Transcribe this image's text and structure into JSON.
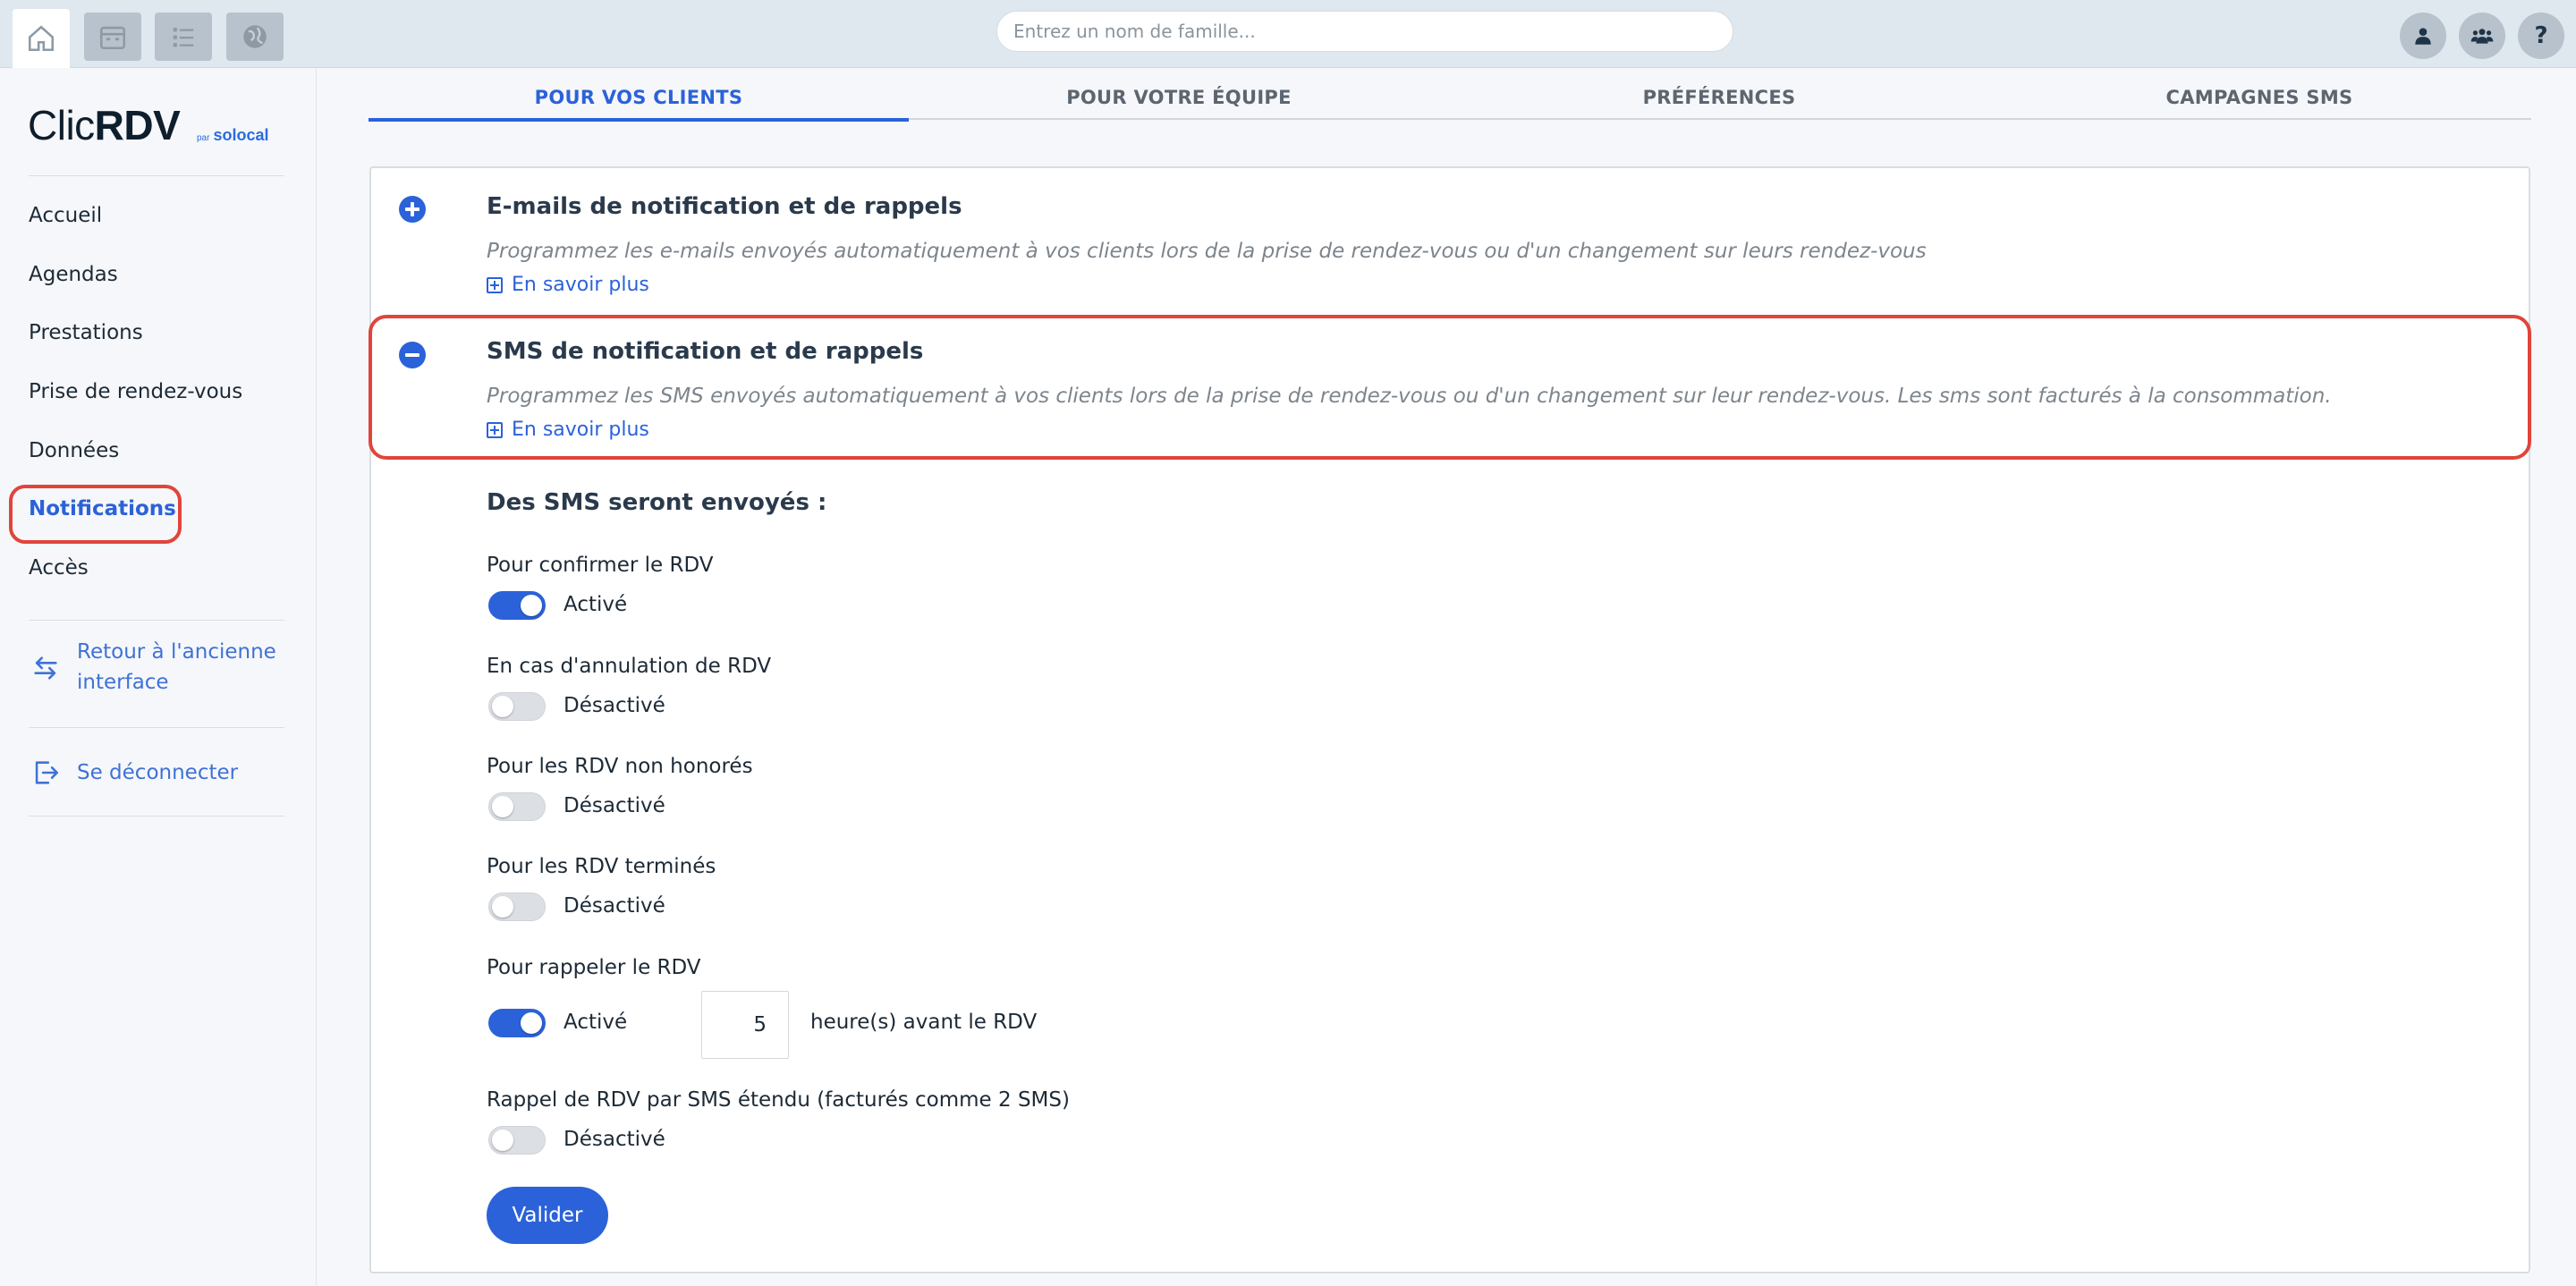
{
  "topbar": {
    "search_placeholder": "Entrez un nom de famille...",
    "icons": [
      "home-icon",
      "calendar-icon",
      "list-icon",
      "globe-icon",
      "user-icon",
      "team-icon",
      "help-icon"
    ],
    "help_glyph": "?"
  },
  "sidebar": {
    "logo_main": "Clic",
    "logo_bold": "RDV",
    "logo_by": "par",
    "logo_brand": "solocal",
    "items": [
      {
        "label": "Accueil"
      },
      {
        "label": "Agendas"
      },
      {
        "label": "Prestations"
      },
      {
        "label": "Prise de rendez-vous"
      },
      {
        "label": "Données"
      },
      {
        "label": "Notifications"
      },
      {
        "label": "Accès"
      }
    ],
    "active_item": "Notifications",
    "back_link": "Retour à l'ancienne interface",
    "back_line1": "Retour à l'ancienne",
    "back_line2": "interface",
    "logout": "Se déconnecter"
  },
  "tabs": [
    {
      "label": "POUR VOS CLIENTS",
      "active": true
    },
    {
      "label": "POUR VOTRE ÉQUIPE",
      "active": false
    },
    {
      "label": "PRÉFÉRENCES",
      "active": false
    },
    {
      "label": "CAMPAGNES SMS",
      "active": false
    }
  ],
  "sections": {
    "email": {
      "title": "E-mails de notification et de rappels",
      "description": "Programmez les e-mails envoyés automatiquement à vos clients lors de la prise de rendez-vous ou d'un changement sur leurs rendez-vous",
      "learn_more": "En savoir plus",
      "expanded": false
    },
    "sms": {
      "title": "SMS de notification et de rappels",
      "description": "Programmez les SMS envoyés automatiquement à vos clients lors de la prise de rendez-vous ou d'un changement sur leur rendez-vous. Les sms sont facturés à la consommation.",
      "learn_more": "En savoir plus",
      "expanded": true
    }
  },
  "sms_settings": {
    "heading": "Des SMS seront envoyés :",
    "options": [
      {
        "label": "Pour confirmer le RDV",
        "enabled": true,
        "state_text": "Activé"
      },
      {
        "label": "En cas d'annulation de RDV",
        "enabled": false,
        "state_text": "Désactivé"
      },
      {
        "label": "Pour les RDV non honorés",
        "enabled": false,
        "state_text": "Désactivé"
      },
      {
        "label": "Pour les RDV terminés",
        "enabled": false,
        "state_text": "Désactivé"
      },
      {
        "label": "Pour rappeler le RDV",
        "enabled": true,
        "state_text": "Activé"
      },
      {
        "label": "Rappel de RDV par SMS étendu (facturés comme 2 SMS)",
        "enabled": false,
        "state_text": "Désactivé"
      }
    ],
    "reminder_hours": "5",
    "reminder_hours_label": "heure(s) avant le RDV",
    "submit_label": "Valider"
  },
  "colors": {
    "accent": "#2b62d9",
    "highlight": "#e0453a",
    "topbar": "#dfe7ef"
  }
}
